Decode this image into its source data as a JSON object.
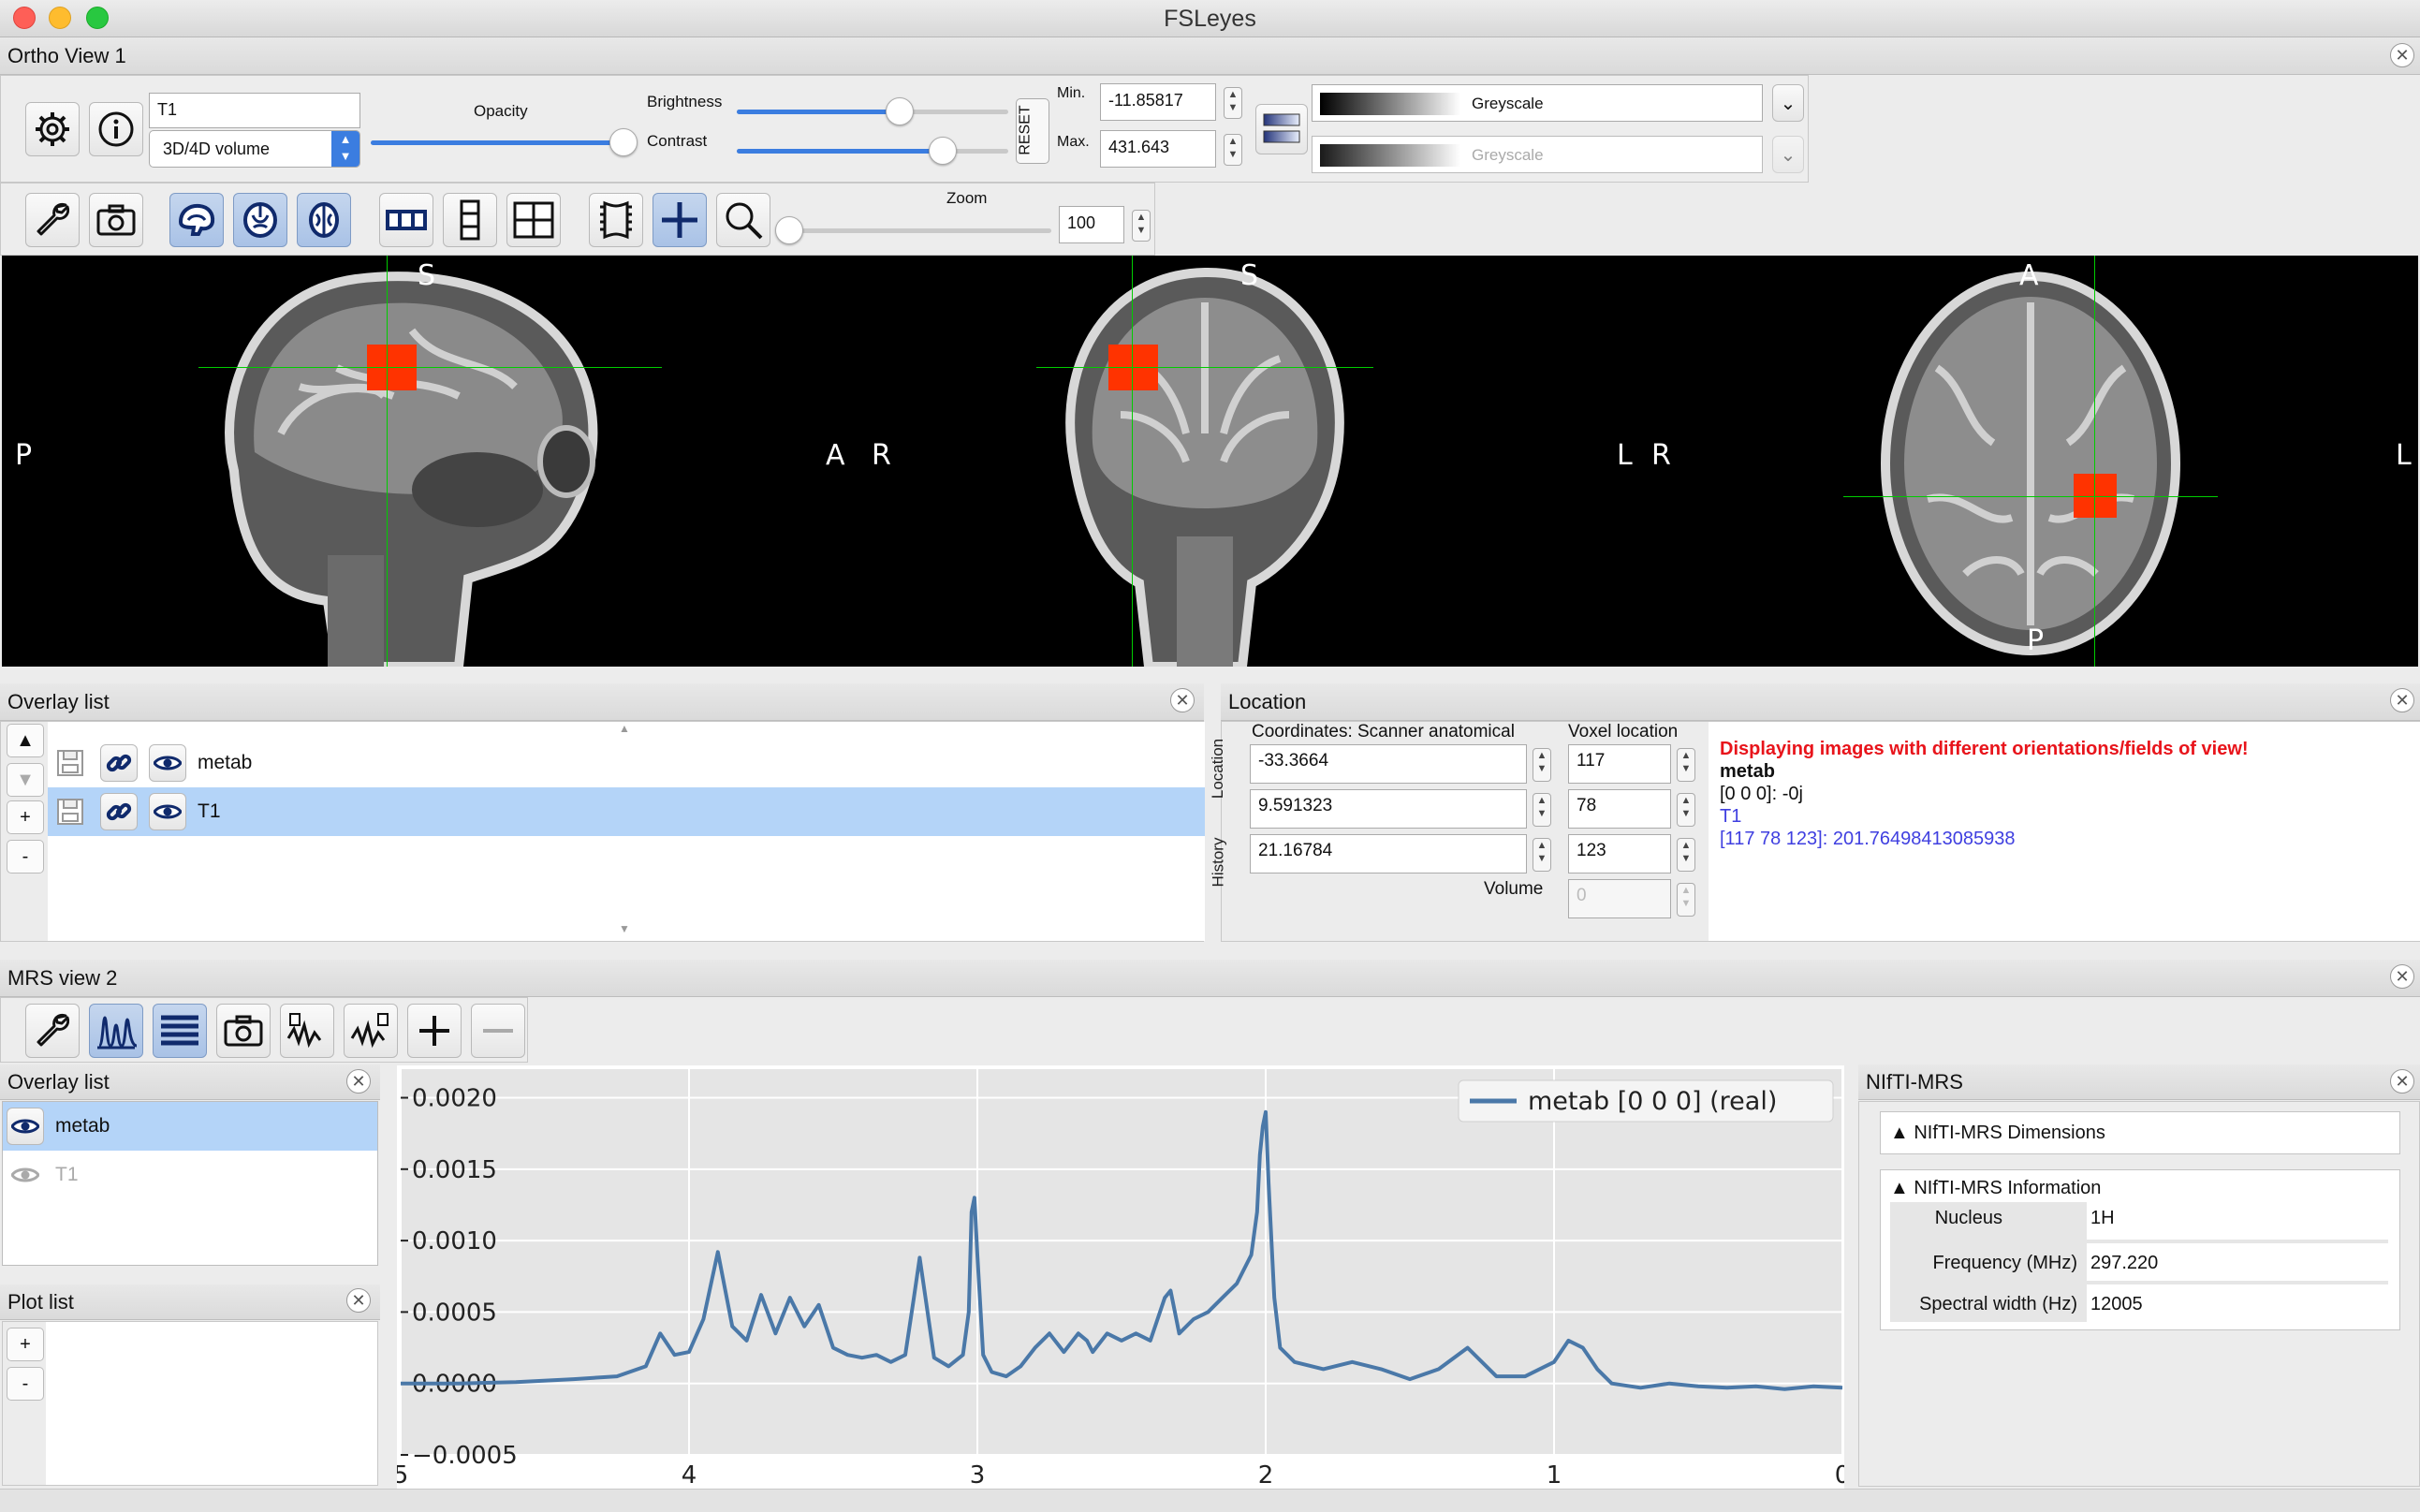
{
  "app": {
    "title": "FSLeyes"
  },
  "colors": {
    "accent": "#3b7de0",
    "crosshair": "#00cc00",
    "overlay": "#ff3300",
    "warning": "#e8141b",
    "t1_link": "#3f3fe0",
    "plot_line": "#4a78a8"
  },
  "ortho": {
    "title": "Ortho View 1",
    "overlay_name": "T1",
    "overlay_type": "3D/4D volume",
    "opacity_label": "Opacity",
    "opacity": 0.98,
    "brightness_label": "Brightness",
    "brightness": 0.6,
    "contrast_label": "Contrast",
    "contrast": 0.76,
    "reset_label": "RESET",
    "min_label": "Min.",
    "min_value": "-11.85817",
    "max_label": "Max.",
    "max_value": "431.643",
    "cmap": "Greyscale",
    "cmap2": "Greyscale",
    "zoom_label": "Zoom",
    "zoom_value": "100",
    "zoom": 0.0,
    "views": {
      "sagittal": {
        "top": "S",
        "left": "P",
        "right": "A"
      },
      "coronal": {
        "top": "S",
        "left": "R",
        "right": "L"
      },
      "axial": {
        "top": "A",
        "left": "R",
        "right": "L",
        "bottom": "P"
      }
    }
  },
  "overlay_list": {
    "title": "Overlay list",
    "items": [
      {
        "name": "metab"
      },
      {
        "name": "T1"
      }
    ]
  },
  "location": {
    "title": "Location",
    "tab_location": "Location",
    "tab_history": "History",
    "coords_header": "Coordinates: Scanner anatomical",
    "voxel_header": "Voxel location",
    "coords": [
      "-33.3664",
      "9.591323",
      "21.16784"
    ],
    "voxels": [
      "117",
      "78",
      "123"
    ],
    "volume_label": "Volume",
    "volume_value": "0",
    "warning": "Displaying images with different orientations/fields of view!",
    "metab_name": "metab",
    "metab_value": "[0 0 0]: -0j",
    "t1_name": "T1",
    "t1_value": "[117 78 123]: 201.76498413085938"
  },
  "mrs": {
    "title": "MRS view 2",
    "overlay_list_title": "Overlay list",
    "overlays": [
      {
        "name": "metab"
      },
      {
        "name": "T1"
      }
    ],
    "plot_list_title": "Plot list",
    "legend": "metab [0 0 0] (real)"
  },
  "chart_data": {
    "type": "line",
    "xlabel": "",
    "ylabel": "",
    "x_reversed": true,
    "xlim": [
      5,
      0
    ],
    "ylim": [
      -0.0005,
      0.0022
    ],
    "x_ticks": [
      "5",
      "4",
      "3",
      "2",
      "1",
      "0"
    ],
    "y_ticks": [
      "0.0020",
      "0.0015",
      "0.0010",
      "0.0005",
      "0.0000",
      "−0.0005"
    ],
    "grid": true,
    "legend_position": "top-right",
    "series": [
      {
        "name": "metab [0 0 0] (real)",
        "x": [
          5.0,
          4.8,
          4.6,
          4.4,
          4.25,
          4.15,
          4.1,
          4.05,
          4.0,
          3.95,
          3.9,
          3.85,
          3.8,
          3.75,
          3.7,
          3.65,
          3.6,
          3.55,
          3.5,
          3.45,
          3.4,
          3.35,
          3.3,
          3.25,
          3.22,
          3.2,
          3.18,
          3.15,
          3.1,
          3.05,
          3.03,
          3.02,
          3.01,
          3.0,
          2.98,
          2.95,
          2.9,
          2.85,
          2.8,
          2.75,
          2.7,
          2.65,
          2.62,
          2.6,
          2.55,
          2.5,
          2.45,
          2.4,
          2.35,
          2.33,
          2.3,
          2.25,
          2.2,
          2.15,
          2.1,
          2.05,
          2.03,
          2.02,
          2.01,
          2.0,
          1.99,
          1.97,
          1.95,
          1.9,
          1.8,
          1.7,
          1.6,
          1.5,
          1.4,
          1.3,
          1.2,
          1.1,
          1.0,
          0.95,
          0.9,
          0.85,
          0.8,
          0.7,
          0.6,
          0.5,
          0.4,
          0.3,
          0.2,
          0.1,
          0.0
        ],
        "y": [
          0.0,
          0.0,
          1e-05,
          3e-05,
          5e-05,
          0.00012,
          0.00035,
          0.0002,
          0.00022,
          0.00045,
          0.00092,
          0.0004,
          0.0003,
          0.00062,
          0.00035,
          0.0006,
          0.0004,
          0.00055,
          0.00025,
          0.0002,
          0.00018,
          0.0002,
          0.00015,
          0.0002,
          0.0006,
          0.00088,
          0.0006,
          0.00018,
          0.00012,
          0.0002,
          0.0005,
          0.0012,
          0.0013,
          0.0009,
          0.0002,
          8e-05,
          5e-05,
          0.00012,
          0.00025,
          0.00035,
          0.00022,
          0.00035,
          0.0003,
          0.00022,
          0.00035,
          0.0003,
          0.00035,
          0.0003,
          0.0006,
          0.00065,
          0.00035,
          0.00045,
          0.0005,
          0.0006,
          0.0007,
          0.0009,
          0.0012,
          0.0016,
          0.0018,
          0.0019,
          0.0014,
          0.0006,
          0.00025,
          0.00015,
          0.0001,
          0.00015,
          0.0001,
          3e-05,
          0.0001,
          0.00025,
          5e-05,
          5e-05,
          0.00015,
          0.0003,
          0.00025,
          0.0001,
          0.0,
          -3e-05,
          0.0,
          -2e-05,
          -3e-05,
          -2e-05,
          -4e-05,
          -2e-05,
          -3e-05
        ]
      }
    ]
  },
  "nifti": {
    "title": "NIfTI-MRS",
    "dims_label": "▲ NIfTI-MRS Dimensions",
    "info_label": "▲ NIfTI-MRS Information",
    "rows": [
      {
        "key": "Nucleus",
        "value": "1H"
      },
      {
        "key": "Frequency (MHz)",
        "value": "297.220"
      },
      {
        "key": "Spectral width (Hz)",
        "value": "12005"
      }
    ]
  }
}
